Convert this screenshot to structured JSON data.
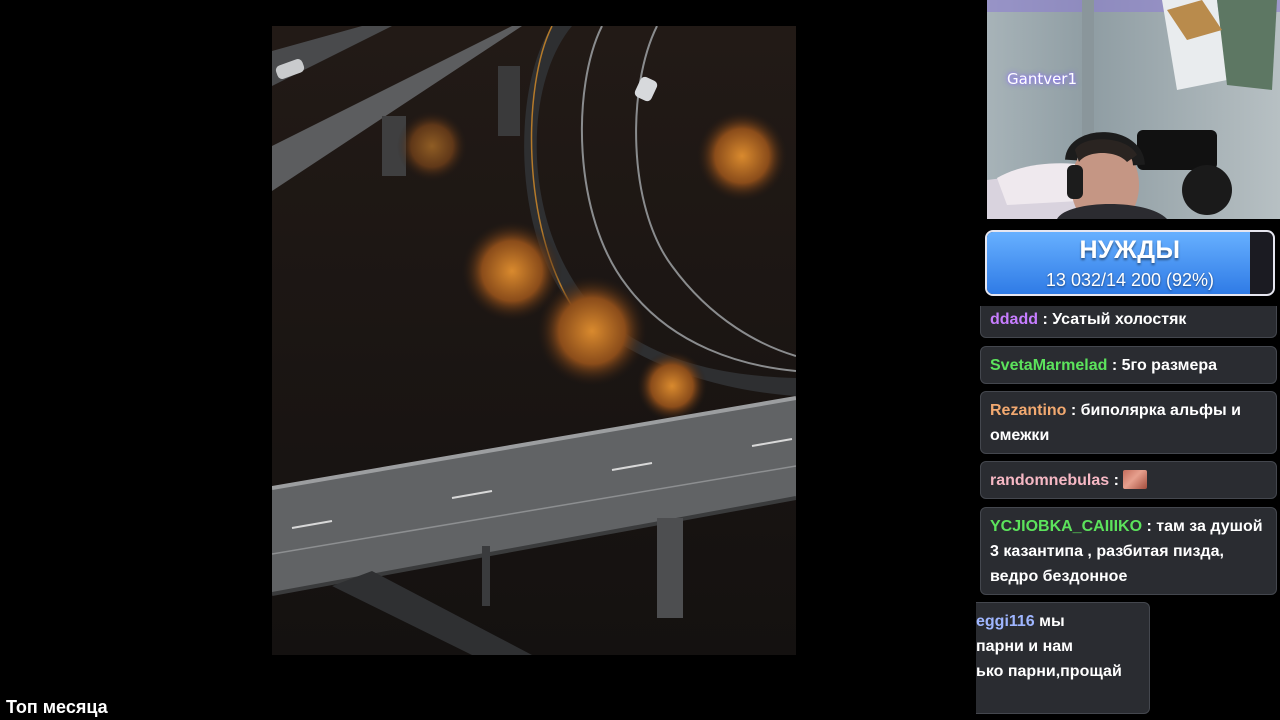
{
  "overlay": {
    "top_month_label": "Топ месяца"
  },
  "webcam": {
    "streamer_name": "Gantver1"
  },
  "goal": {
    "title": "НУЖДЫ",
    "progress_text": "13 032/14 200 (92%)",
    "current": 13032,
    "target": 14200,
    "percent": 92,
    "fill_color": "#3b8cf0"
  },
  "chat": {
    "messages": [
      {
        "user": "ddadd",
        "separator": " : ",
        "text": "Усатый холостяк",
        "color": "#c77dff"
      },
      {
        "user": "SvetaMarmelad",
        "separator": " : ",
        "text": "5го размера",
        "color": "#5ce35c"
      },
      {
        "user": "Rezantino",
        "separator": " : ",
        "text": "биполярка альфы и омежки",
        "color": "#f2a970"
      },
      {
        "user": "randomnebulas",
        "separator": " : ",
        "text": "",
        "emote": "emote",
        "color": "#f6b8c4"
      },
      {
        "user": "YCJIOBKA_CAIIIKO",
        "separator": " : ",
        "text": "там за душой 3 казантипа , разбитая пизда, ведро бездонное",
        "color": "#5ce35c"
      },
      {
        "user": "eggi116",
        "separator": " ",
        "text": "мы",
        "color": "#9fb6ff",
        "line2": "парни и нам",
        "line3": "ько парни,прощай"
      }
    ]
  }
}
